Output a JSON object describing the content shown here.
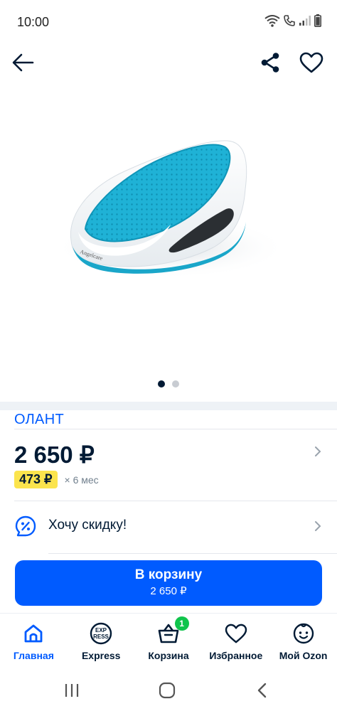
{
  "status_bar": {
    "time": "10:00",
    "icons": [
      "wifi-icon",
      "call-icon",
      "signal-icon",
      "battery-icon"
    ]
  },
  "top_bar": {
    "back_icon": "arrow-left-icon",
    "share_icon": "share-icon",
    "favorite_icon": "heart-icon"
  },
  "gallery": {
    "image": "baby-bath-seat-image",
    "image_brand_print": "Angelcare",
    "dots_total": 2,
    "dots_active_index": 0
  },
  "product": {
    "brand": "ОЛАНТ",
    "price": "2 650 ₽",
    "installment_amount": "473 ₽",
    "installment_term": "× 6 мес"
  },
  "discount": {
    "label": "Хочу скидку!",
    "icon": "discount-percent-icon"
  },
  "cart_button": {
    "label": "В корзину",
    "price": "2 650 ₽"
  },
  "bottom_nav": {
    "items": [
      {
        "label": "Главная",
        "icon": "home-icon",
        "active": true
      },
      {
        "label": "Express",
        "icon": "express-icon",
        "icon_text_top": "EXP",
        "icon_text_bottom": "RESS"
      },
      {
        "label": "Корзина",
        "icon": "basket-icon",
        "badge": "1"
      },
      {
        "label": "Избранное",
        "icon": "heart-icon"
      },
      {
        "label": "Мой Ozon",
        "icon": "profile-face-icon"
      }
    ]
  },
  "colors": {
    "accent": "#005bff",
    "price_badge": "#fbe44d",
    "cart_badge": "#10c44c",
    "text": "#001a34",
    "product_teal": "#1fb2d6"
  }
}
